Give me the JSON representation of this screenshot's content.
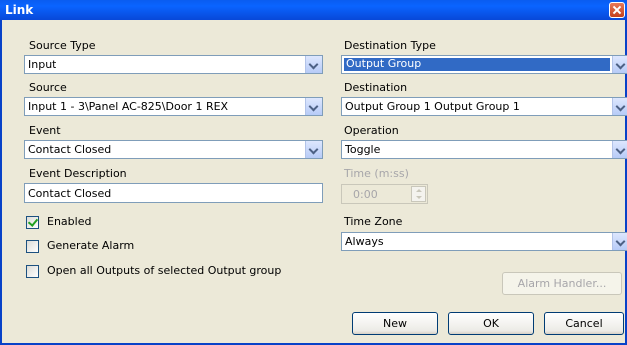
{
  "window": {
    "title": "Link"
  },
  "source_type": {
    "label": "Source Type",
    "value": "Input"
  },
  "source": {
    "label": "Source",
    "value": "Input 1 - 3\\Panel  AC-825\\Door 1 REX"
  },
  "event": {
    "label": "Event",
    "value": "Contact Closed"
  },
  "event_description": {
    "label": "Event Description",
    "value": "Contact Closed"
  },
  "enabled": {
    "label": "Enabled",
    "checked": true
  },
  "generate_alarm": {
    "label": "Generate Alarm",
    "checked": false
  },
  "open_all_outputs": {
    "label": "Open all Outputs of selected Output group",
    "checked": false
  },
  "destination_type": {
    "label": "Destination Type",
    "value": "Output Group"
  },
  "destination": {
    "label": "Destination",
    "value": "Output Group 1 Output Group 1"
  },
  "operation": {
    "label": "Operation",
    "value": "Toggle"
  },
  "time": {
    "label": "Time (m:ss)",
    "value": "0:00"
  },
  "time_zone": {
    "label": "Time Zone",
    "value": "Always"
  },
  "buttons": {
    "alarm_handler": "Alarm Handler...",
    "new": "New",
    "ok": "OK",
    "cancel": "Cancel"
  },
  "colors": {
    "titlebar": "#0A5CF0",
    "dialog_bg": "#ECE9D8",
    "selection": "#316AC5",
    "close": "#C4401C"
  },
  "icons": {
    "close": "close-icon",
    "dropdown": "chevron-down-icon",
    "check": "checkmark-icon"
  }
}
